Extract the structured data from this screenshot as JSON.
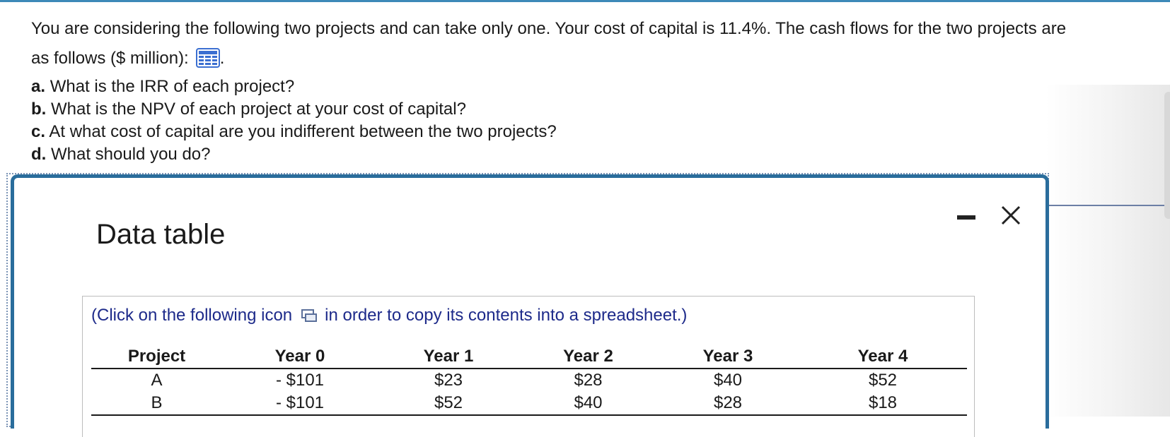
{
  "question": {
    "line1": "You are considering the following two projects and can take only one. Your cost of capital is 11.4%. The cash flows for the two projects are",
    "line2": "as follows ($ million):",
    "line2_end": ".",
    "grid_icon": "table-grid-icon",
    "parts": [
      {
        "letter": "a.",
        "text": "What is the IRR of each project?"
      },
      {
        "letter": "b.",
        "text": "What is the NPV of each project at your cost of capital?"
      },
      {
        "letter": "c.",
        "text": "At what cost of capital are you indifferent between the two projects?"
      },
      {
        "letter": "d.",
        "text": "What should you do?"
      }
    ]
  },
  "modal": {
    "title": "Data table",
    "minimize_icon": "minimize-icon",
    "close_icon": "close-icon",
    "copy_note_before": "(Click on the following icon",
    "copy_note_after": "in order to copy its contents into a spreadsheet.)",
    "copy_icon": "copy-icon",
    "table": {
      "headers": [
        "Project",
        "Year 0",
        "Year 1",
        "Year 2",
        "Year 3",
        "Year 4"
      ],
      "rows": [
        [
          "A",
          "- $101",
          "$23",
          "$28",
          "$40",
          "$52"
        ],
        [
          "B",
          "- $101",
          "$52",
          "$40",
          "$28",
          "$18"
        ]
      ]
    }
  },
  "colors": {
    "accent": "#2a6d9c",
    "link_text": "#1d2a8a",
    "grid_icon": "#3b6fd1"
  }
}
